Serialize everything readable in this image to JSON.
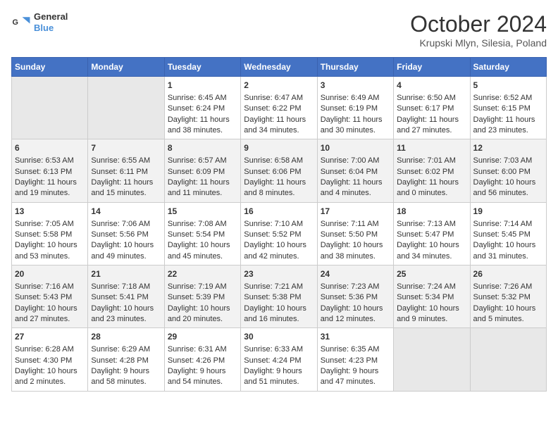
{
  "header": {
    "logo_line1": "General",
    "logo_line2": "Blue",
    "title": "October 2024",
    "subtitle": "Krupski Mlyn, Silesia, Poland"
  },
  "days_of_week": [
    "Sunday",
    "Monday",
    "Tuesday",
    "Wednesday",
    "Thursday",
    "Friday",
    "Saturday"
  ],
  "weeks": [
    [
      {
        "day": "",
        "info": ""
      },
      {
        "day": "",
        "info": ""
      },
      {
        "day": "1",
        "info": "Sunrise: 6:45 AM\nSunset: 6:24 PM\nDaylight: 11 hours and 38 minutes."
      },
      {
        "day": "2",
        "info": "Sunrise: 6:47 AM\nSunset: 6:22 PM\nDaylight: 11 hours and 34 minutes."
      },
      {
        "day": "3",
        "info": "Sunrise: 6:49 AM\nSunset: 6:19 PM\nDaylight: 11 hours and 30 minutes."
      },
      {
        "day": "4",
        "info": "Sunrise: 6:50 AM\nSunset: 6:17 PM\nDaylight: 11 hours and 27 minutes."
      },
      {
        "day": "5",
        "info": "Sunrise: 6:52 AM\nSunset: 6:15 PM\nDaylight: 11 hours and 23 minutes."
      }
    ],
    [
      {
        "day": "6",
        "info": "Sunrise: 6:53 AM\nSunset: 6:13 PM\nDaylight: 11 hours and 19 minutes."
      },
      {
        "day": "7",
        "info": "Sunrise: 6:55 AM\nSunset: 6:11 PM\nDaylight: 11 hours and 15 minutes."
      },
      {
        "day": "8",
        "info": "Sunrise: 6:57 AM\nSunset: 6:09 PM\nDaylight: 11 hours and 11 minutes."
      },
      {
        "day": "9",
        "info": "Sunrise: 6:58 AM\nSunset: 6:06 PM\nDaylight: 11 hours and 8 minutes."
      },
      {
        "day": "10",
        "info": "Sunrise: 7:00 AM\nSunset: 6:04 PM\nDaylight: 11 hours and 4 minutes."
      },
      {
        "day": "11",
        "info": "Sunrise: 7:01 AM\nSunset: 6:02 PM\nDaylight: 11 hours and 0 minutes."
      },
      {
        "day": "12",
        "info": "Sunrise: 7:03 AM\nSunset: 6:00 PM\nDaylight: 10 hours and 56 minutes."
      }
    ],
    [
      {
        "day": "13",
        "info": "Sunrise: 7:05 AM\nSunset: 5:58 PM\nDaylight: 10 hours and 53 minutes."
      },
      {
        "day": "14",
        "info": "Sunrise: 7:06 AM\nSunset: 5:56 PM\nDaylight: 10 hours and 49 minutes."
      },
      {
        "day": "15",
        "info": "Sunrise: 7:08 AM\nSunset: 5:54 PM\nDaylight: 10 hours and 45 minutes."
      },
      {
        "day": "16",
        "info": "Sunrise: 7:10 AM\nSunset: 5:52 PM\nDaylight: 10 hours and 42 minutes."
      },
      {
        "day": "17",
        "info": "Sunrise: 7:11 AM\nSunset: 5:50 PM\nDaylight: 10 hours and 38 minutes."
      },
      {
        "day": "18",
        "info": "Sunrise: 7:13 AM\nSunset: 5:47 PM\nDaylight: 10 hours and 34 minutes."
      },
      {
        "day": "19",
        "info": "Sunrise: 7:14 AM\nSunset: 5:45 PM\nDaylight: 10 hours and 31 minutes."
      }
    ],
    [
      {
        "day": "20",
        "info": "Sunrise: 7:16 AM\nSunset: 5:43 PM\nDaylight: 10 hours and 27 minutes."
      },
      {
        "day": "21",
        "info": "Sunrise: 7:18 AM\nSunset: 5:41 PM\nDaylight: 10 hours and 23 minutes."
      },
      {
        "day": "22",
        "info": "Sunrise: 7:19 AM\nSunset: 5:39 PM\nDaylight: 10 hours and 20 minutes."
      },
      {
        "day": "23",
        "info": "Sunrise: 7:21 AM\nSunset: 5:38 PM\nDaylight: 10 hours and 16 minutes."
      },
      {
        "day": "24",
        "info": "Sunrise: 7:23 AM\nSunset: 5:36 PM\nDaylight: 10 hours and 12 minutes."
      },
      {
        "day": "25",
        "info": "Sunrise: 7:24 AM\nSunset: 5:34 PM\nDaylight: 10 hours and 9 minutes."
      },
      {
        "day": "26",
        "info": "Sunrise: 7:26 AM\nSunset: 5:32 PM\nDaylight: 10 hours and 5 minutes."
      }
    ],
    [
      {
        "day": "27",
        "info": "Sunrise: 6:28 AM\nSunset: 4:30 PM\nDaylight: 10 hours and 2 minutes."
      },
      {
        "day": "28",
        "info": "Sunrise: 6:29 AM\nSunset: 4:28 PM\nDaylight: 9 hours and 58 minutes."
      },
      {
        "day": "29",
        "info": "Sunrise: 6:31 AM\nSunset: 4:26 PM\nDaylight: 9 hours and 54 minutes."
      },
      {
        "day": "30",
        "info": "Sunrise: 6:33 AM\nSunset: 4:24 PM\nDaylight: 9 hours and 51 minutes."
      },
      {
        "day": "31",
        "info": "Sunrise: 6:35 AM\nSunset: 4:23 PM\nDaylight: 9 hours and 47 minutes."
      },
      {
        "day": "",
        "info": ""
      },
      {
        "day": "",
        "info": ""
      }
    ]
  ]
}
